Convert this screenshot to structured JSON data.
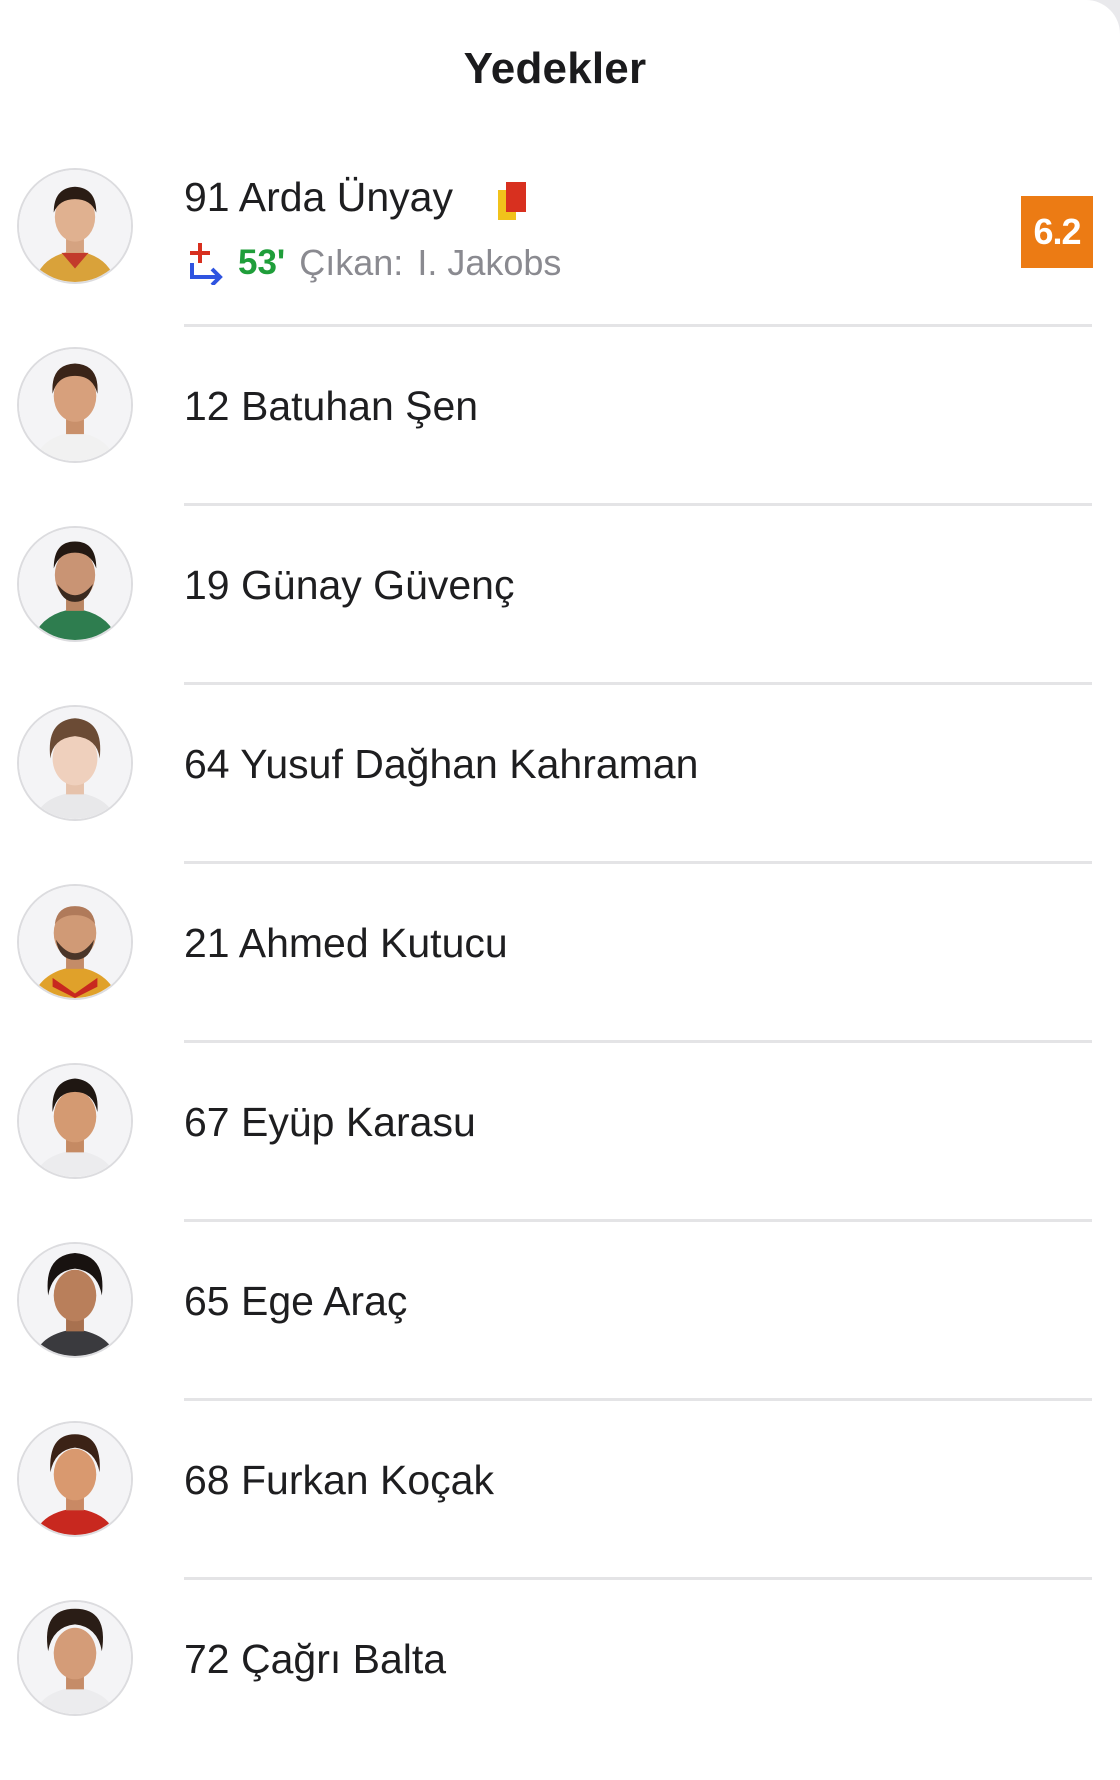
{
  "header": {
    "title": "Yedekler"
  },
  "colors": {
    "rating_bg": "#ec7b14",
    "sub_minute": "#1f9e3a",
    "divider": "#e4e4e6"
  },
  "players": [
    {
      "label": "91 Arda Ünyay",
      "icon": "yellow-red-card-icon",
      "substitution": {
        "icon": "substitution-in-icon",
        "minute": "53'",
        "label": "Çıkan:",
        "player": "I. Jakobs"
      },
      "rating": "6.2"
    },
    {
      "label": "12 Batuhan Şen"
    },
    {
      "label": "19 Günay Güvenç"
    },
    {
      "label": "64 Yusuf Dağhan Kahraman"
    },
    {
      "label": "21 Ahmed Kutucu"
    },
    {
      "label": "67 Eyüp Karasu"
    },
    {
      "label": "65 Ege Araç"
    },
    {
      "label": "68 Furkan Koçak"
    },
    {
      "label": "72 Çağrı Balta"
    }
  ]
}
